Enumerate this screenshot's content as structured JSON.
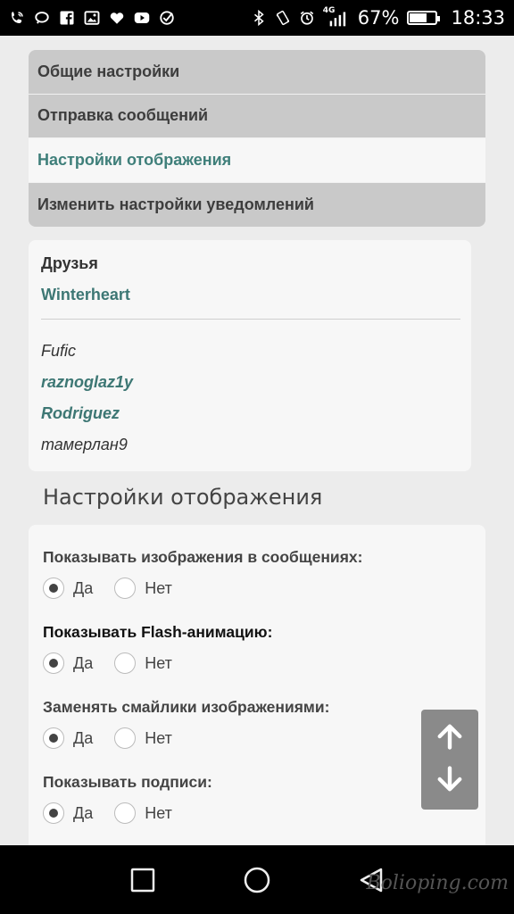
{
  "status_bar": {
    "battery_percent": "67%",
    "time": "18:33",
    "network_label": "4G",
    "battery_level": 0.67,
    "left_icons": [
      "phone-wifi-icon",
      "chat-bubble-icon",
      "facebook-icon",
      "image-icon",
      "heart-icon",
      "youtube-icon",
      "check-circle-icon"
    ],
    "right_icons": [
      "bluetooth-icon",
      "vibrate-icon",
      "alarm-icon",
      "signal-icon",
      "battery-icon"
    ]
  },
  "menu": {
    "items": [
      {
        "label": "Общие настройки"
      },
      {
        "label": "Отправка сообщений"
      },
      {
        "label": "Настройки отображения"
      },
      {
        "label": "Изменить настройки уведомлений"
      }
    ],
    "active_index": 2
  },
  "friends": {
    "title": "Друзья",
    "main": "Winterheart",
    "list": [
      {
        "name": "Fufic"
      },
      {
        "name": "raznoglaz1y"
      },
      {
        "name": "Rodriguez"
      },
      {
        "name": "тамерлан9"
      }
    ]
  },
  "section": {
    "title": "Настройки отображения"
  },
  "options": [
    {
      "label": "Показывать изображения в сообщениях:",
      "yes": "Да",
      "no": "Нет",
      "selected": "yes"
    },
    {
      "label": "Показывать Flash-анимацию:",
      "yes": "Да",
      "no": "Нет",
      "selected": "yes"
    },
    {
      "label": "Заменять смайлики изображениями:",
      "yes": "Да",
      "no": "Нет",
      "selected": "yes"
    },
    {
      "label": "Показывать подписи:",
      "yes": "Да",
      "no": "Нет",
      "selected": "yes"
    }
  ],
  "watermark": "Bolioping.com",
  "colors": {
    "accent": "#3f7f7a",
    "menu_inactive": "#c9c9c9",
    "card_bg": "#f7f7f7",
    "page_bg": "#ececec"
  }
}
